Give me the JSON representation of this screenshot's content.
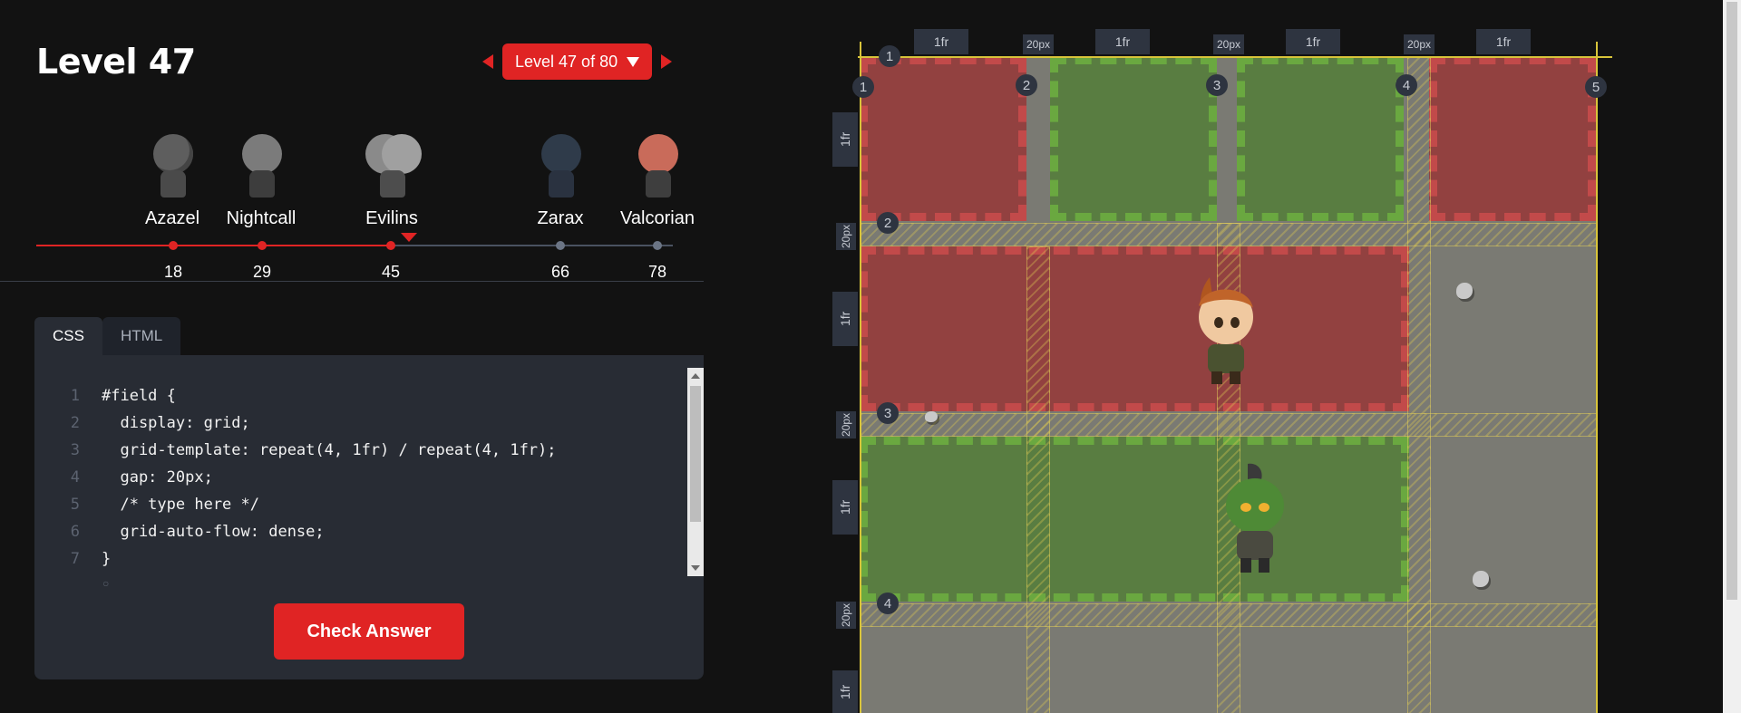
{
  "header": {
    "title": "Level 47",
    "level_select": "Level 47 of 80"
  },
  "characters": [
    {
      "name": "Azazel",
      "level": "18",
      "state": "done"
    },
    {
      "name": "Nightcall",
      "level": "29",
      "state": "done"
    },
    {
      "name": "Evilins",
      "level": "45",
      "state": "current"
    },
    {
      "name": "Zarax",
      "level": "66",
      "state": "upcoming"
    },
    {
      "name": "Valcorian",
      "level": "78",
      "state": "upcoming"
    }
  ],
  "editor": {
    "tabs": [
      "CSS",
      "HTML"
    ],
    "active_tab": "CSS",
    "lines": [
      {
        "n": "1",
        "code": "#field {"
      },
      {
        "n": "2",
        "code": "  display: grid;"
      },
      {
        "n": "3",
        "code": "  grid-template: repeat(4, 1fr) / repeat(4, 1fr);"
      },
      {
        "n": "4",
        "code": "  gap: 20px;"
      },
      {
        "n": "5",
        "code": "  /* type here */"
      },
      {
        "n": "6",
        "code": "  grid-auto-flow: dense;"
      },
      {
        "n": "7",
        "code": "}"
      }
    ],
    "check_button": "Check Answer"
  },
  "board": {
    "column_tracks": [
      "1fr",
      "20px",
      "1fr",
      "20px",
      "1fr",
      "20px",
      "1fr"
    ],
    "row_tracks": [
      "1fr",
      "20px",
      "1fr",
      "20px",
      "1fr",
      "20px",
      "1fr"
    ],
    "column_lines": [
      "1",
      "2",
      "3",
      "4",
      "5"
    ],
    "row_lines": [
      "1",
      "2",
      "3",
      "4"
    ],
    "colors": {
      "red_zone": "#963737",
      "green_zone": "#557d3c",
      "grid_overlay": "#d8c43a"
    }
  }
}
